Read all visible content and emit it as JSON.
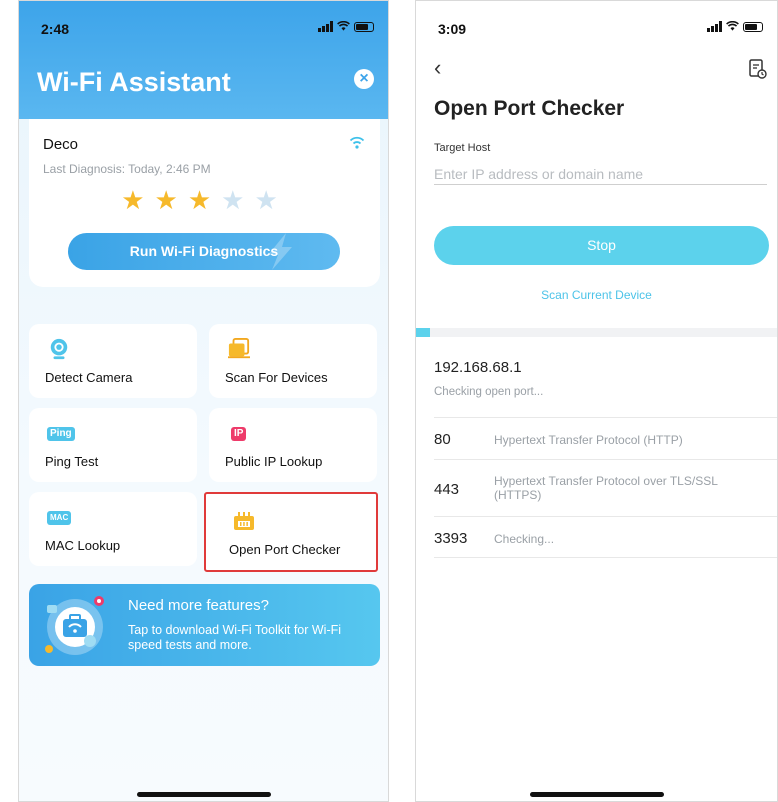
{
  "left": {
    "status_time": "2:48",
    "title": "Wi-Fi Assistant",
    "close_icon": "close-circle-icon",
    "deco": {
      "name": "Deco",
      "last_diagnosis": "Last Diagnosis: Today, 2:46 PM",
      "rating": 3,
      "rating_max": 5,
      "star_char": "★",
      "diagnostics_button": "Run Wi-Fi Diagnostics"
    },
    "tools": [
      {
        "label": "Detect Camera",
        "icon": "camera-icon"
      },
      {
        "label": "Scan For Devices",
        "icon": "devices-icon"
      },
      {
        "label": "Ping Test",
        "icon": "ping-icon",
        "tag": "Ping"
      },
      {
        "label": "Public IP Lookup",
        "icon": "ip-icon",
        "tag": "IP"
      },
      {
        "label": "MAC Lookup",
        "icon": "mac-icon",
        "tag": "MAC"
      },
      {
        "label": "Open Port Checker",
        "icon": "port-icon",
        "selected": true
      }
    ],
    "promo": {
      "title": "Need more features?",
      "subtitle": "Tap to download Wi-Fi Toolkit for Wi-Fi speed tests and more."
    }
  },
  "right": {
    "status_time": "3:09",
    "back_icon": "‹",
    "title": "Open Port Checker",
    "target_host_label": "Target Host",
    "target_host_placeholder": "Enter IP address or domain name",
    "stop_button": "Stop",
    "scan_current": "Scan Current Device",
    "progress": 0.04,
    "host": "192.168.68.1",
    "status_text": "Checking open port...",
    "ports": [
      {
        "port": "80",
        "desc": "Hypertext Transfer Protocol (HTTP)"
      },
      {
        "port": "443",
        "desc": "Hypertext Transfer Protocol over TLS/SSL (HTTPS)"
      },
      {
        "port": "3393",
        "desc": "Checking..."
      }
    ]
  },
  "colors": {
    "brand_blue": "#3da4ea",
    "cyan": "#5cd2ec",
    "star": "#f6b92b",
    "highlight": "#e03a3a"
  }
}
